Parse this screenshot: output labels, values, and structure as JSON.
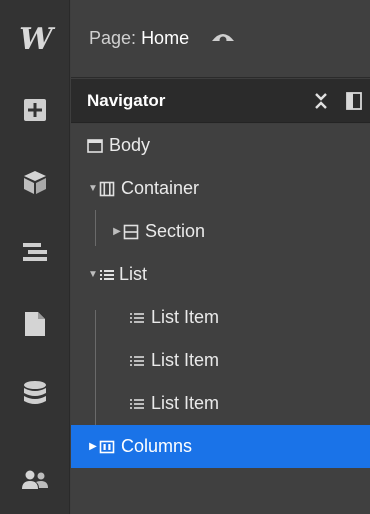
{
  "app": {
    "logo_text": "W"
  },
  "topbar": {
    "page_prefix": "Page:",
    "page_name": "Home"
  },
  "navigator": {
    "title": "Navigator"
  },
  "tree": {
    "body": "Body",
    "container": "Container",
    "section": "Section",
    "list": "List",
    "list_items": [
      "List Item",
      "List Item",
      "List Item"
    ],
    "columns": "Columns"
  },
  "colors": {
    "selected": "#1a73e8",
    "rail": "#333333",
    "panel": "#404040"
  },
  "icons": {
    "rail": [
      "add-icon",
      "components-icon",
      "navigator-icon",
      "pages-icon",
      "cms-icon",
      "users-icon"
    ],
    "header": [
      "collapse-all-icon",
      "dock-panel-icon"
    ],
    "topbar": [
      "eye-icon"
    ]
  }
}
